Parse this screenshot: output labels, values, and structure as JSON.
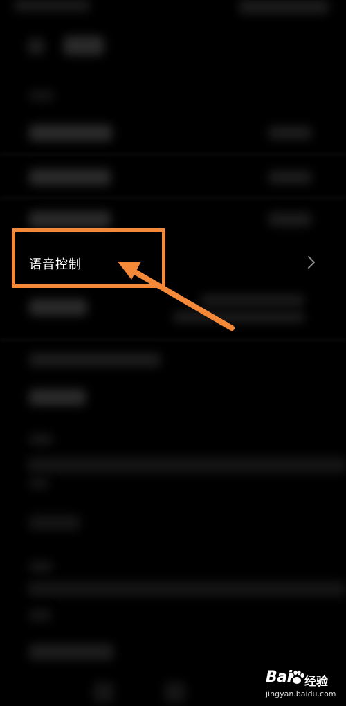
{
  "settings_list": {
    "highlighted_item": {
      "label": "语音控制",
      "chevron_icon": "chevron-right-icon"
    }
  },
  "annotation": {
    "highlight_color": "#f5893a",
    "arrow_color": "#f5893a"
  },
  "watermark": {
    "brand": "Bai",
    "brand_icon": "paw-icon",
    "brand_cn": "经验",
    "url": "jingyan.baidu.com"
  }
}
